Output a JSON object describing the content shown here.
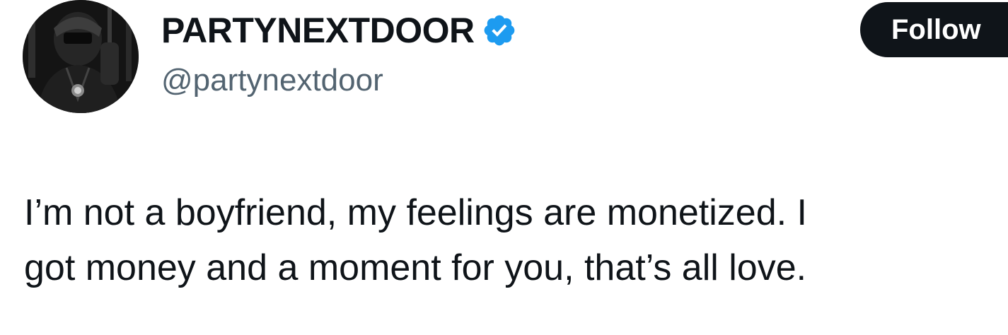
{
  "author": {
    "display_name": "PARTYNEXTDOOR",
    "handle": "@partynextdoor",
    "verified_icon": "verified-badge-icon",
    "verified_color": "#1d9bf0"
  },
  "actions": {
    "follow_label": "Follow"
  },
  "tweet": {
    "lines": [
      "I’m not a boyfriend, my feelings are monetized. I",
      "got money and a moment for you, that’s all love."
    ]
  }
}
